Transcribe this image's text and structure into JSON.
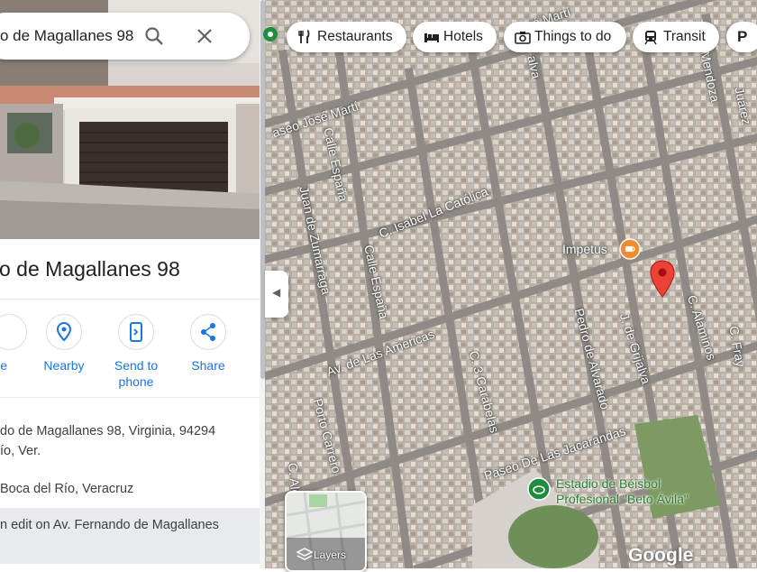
{
  "search": {
    "value": "o de Magallanes 98"
  },
  "place": {
    "title": "o de Magallanes 98"
  },
  "actions": [
    {
      "label": "e"
    },
    {
      "label": "Nearby"
    },
    {
      "label": "Send to phone"
    },
    {
      "label": "Share"
    }
  ],
  "info": {
    "address_line1": "do de Magallanes 98, Virginia, 94294",
    "address_line2": "ío, Ver.",
    "locality": "Boca del Río, Veracruz",
    "edit_text": "n edit on Av. Fernando de Magallanes"
  },
  "filter_chips": [
    {
      "label": "Restaurants",
      "icon": "fork-knife-icon"
    },
    {
      "label": "Hotels",
      "icon": "bed-icon"
    },
    {
      "label": "Things to do",
      "icon": "camera-icon"
    },
    {
      "label": "Transit",
      "icon": "train-icon"
    },
    {
      "label": "P",
      "icon": "parking-icon"
    }
  ],
  "map": {
    "streets": [
      "aseo José Martí",
      "Calle España",
      "Juan de Zumárraga",
      "C. Isabel La Católica",
      "Calle España",
      "Av. de Las Americas",
      "C. 3 Carabelas",
      "Pedro de Alvarado",
      "J. de Grijalva",
      "C. Alaminos",
      "Paseo De Las Jacarandas",
      "C. Alonso de Ávila",
      "Porto Carrero",
      "Mendoza",
      "C. Fray",
      "José Martí",
      "alva",
      "Juárez"
    ],
    "poi_impetus": "Impetus",
    "poi_stadium_line1": "Estadio de Béisbol",
    "poi_stadium_line2": "Profesional \"Beto Ávila\"",
    "layers_label": "Layers",
    "logo": "Google",
    "colors": {
      "pin": "#ea4335",
      "poi_food": "#f28b2e",
      "poi_park": "#1e8e3e"
    }
  }
}
